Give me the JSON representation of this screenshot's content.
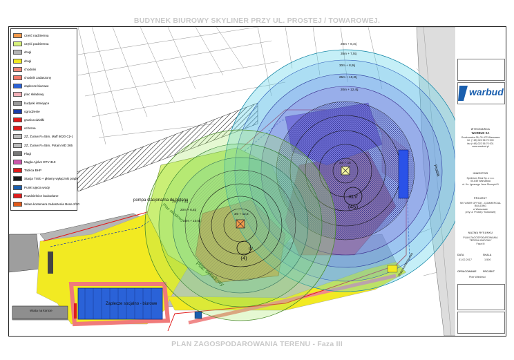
{
  "title": "BUDYNEK BIUROWY SKYLINER PRZY UL. PROSTEJ / TOWAROWEJ.",
  "footer": "PLAN ZAGOSPODAROWANIA TERENU - Faza III",
  "legend": [
    {
      "label": "część nadziemna",
      "color": "#f39a4a"
    },
    {
      "label": "część podziemna",
      "color": "#d8f27c"
    },
    {
      "label": "drogi",
      "color": "#b3b3b3"
    },
    {
      "label": "drogi",
      "color": "#f2ea22"
    },
    {
      "label": "chodniki",
      "color": "#f08a7a"
    },
    {
      "label": "chodnik zadaszony",
      "color": "#f07a6a"
    },
    {
      "label": "zaplecze biurowe",
      "color": "#2a62d8"
    },
    {
      "label": "plac składowy",
      "color": "#f2b0b8"
    },
    {
      "label": "budynki istniejące",
      "color": "#999999"
    },
    {
      "label": "ogrodzenie",
      "color": "#1a3ca8"
    },
    {
      "label": "granica działki",
      "color": "#e01a1a"
    },
    {
      "label": "ochrona",
      "color": "#e01a1a"
    },
    {
      "label": "ZŻ, Żuraw R=45m, Maff 8020 C(+)",
      "color": "#bbbbbb"
    },
    {
      "label": "ZŻ, Żuraw R=45m, Potain MD 365",
      "color": "#bbbbbb"
    },
    {
      "label": "Flagi",
      "color": "#777777"
    },
    {
      "label": "Mągla Ajelve DTV 310",
      "color": "#cc55aa"
    },
    {
      "label": "Tablica BHP",
      "color": "#e01a1a"
    },
    {
      "label": "Stacja Trafo + główny wyłącznik prądu",
      "color": "#1a1a1a"
    },
    {
      "label": "Punkt ujęcia wody",
      "color": "#1a5fae"
    },
    {
      "label": "Rozdzielnice budowlane",
      "color": "#e01a1a"
    },
    {
      "label": "Wiata kontenera zadaszenia Bosa 2/20",
      "color": "#e05a1a"
    }
  ],
  "map": {
    "crane_labels": [
      {
        "name": "crane-xlv-label",
        "text": "XLV"
      },
      {
        "name": "crane-xlv-num",
        "text": "(45)"
      },
      {
        "name": "crane-iv-label",
        "text": "IV"
      },
      {
        "name": "crane-iv-num",
        "text": "(4)"
      }
    ],
    "range_labels": [
      "28m + 8,4tj",
      "35m + 7,5tj",
      "30m + 8,9tj",
      "25m + 10,2tj",
      "20m + 12,4tj",
      "3m + 16",
      "25m + 7,4tj",
      "20m + 8,4tj",
      "22m + 10,0tj",
      "3m + 12,5"
    ],
    "area_labels": [
      "pompa stacjonarna do betonu",
      "Plac składowy",
      "Plac składowy",
      "Zaplecze socjalno - biurowe",
      "Wiata na koncie",
      "Wiata kontenerowa"
    ],
    "street_label": "Prosta"
  },
  "sidebar": {
    "company_heading": "WYKONAWCA",
    "company_name": "WARBUD SA",
    "company_lines": [
      "Grochowska 26, 03-472 Warszawa",
      "tel. (+48) 022 56 70 000",
      "fax (+48) 022 56 70 001",
      "www.warbud.pl"
    ],
    "investor_heading": "INWESTOR",
    "investor_lines": [
      "Spektrum Real Sp. z o.o.",
      "00-649 Warszawa",
      "ul. Ks. Ignacego Jana Skorupki 5"
    ],
    "project_heading": "PROJEKT",
    "project_lines": [
      "SKYLINER OFFICE - COMMERCIAL",
      "BUILDING",
      "w Warszawie",
      "przy ul. Prostej / Towarowej"
    ],
    "drawing_heading": "NAZWA RYSUNKU",
    "drawing_lines": [
      "PLAN ZAGOSPODAROWANIA",
      "TERENU BUDOWY",
      "Faza III"
    ],
    "date_heading": "DATA",
    "date_value": "01.02.2017",
    "scale_heading": "SKALA",
    "scale_value": "1:500",
    "author_heading": "OPRACOWANIE",
    "check_heading": "PROJEKT",
    "author_value": "Piotr Wiśniński",
    "logo_text": "warbud"
  }
}
